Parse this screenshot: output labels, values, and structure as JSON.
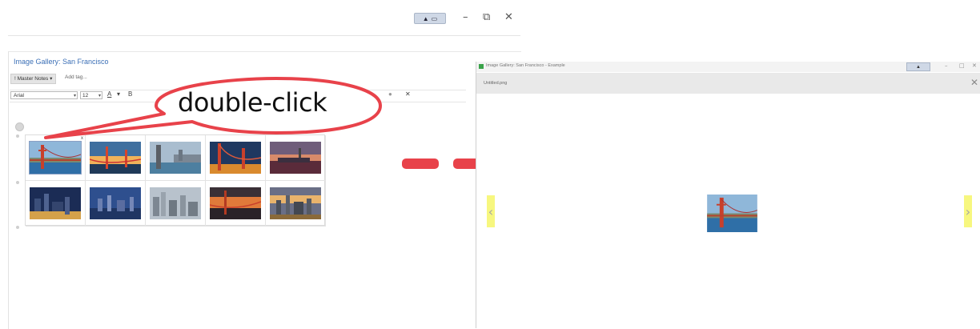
{
  "window": {
    "minimize_glyph": "–",
    "restore_glyph": "⧉",
    "close_glyph": "✕",
    "toggle_glyph": "▲",
    "toggle_sub": "▭"
  },
  "page": {
    "title": "Image Gallery: San Francisco",
    "tag_label": "! Master Notes ▾",
    "add_tag": "Add tag..."
  },
  "format_bar": {
    "font": "Arial",
    "size": "12",
    "icons": [
      "A",
      "▾",
      "B",
      "●",
      "✕"
    ]
  },
  "callout": {
    "text": "double-click"
  },
  "gallery": {
    "rows": 2,
    "columns": 5,
    "thumbnails": [
      "golden-gate-thumbnail",
      "golden-gate-sunset-thumbnail",
      "bay-bridge-thumbnail",
      "golden-gate-night-thumbnail",
      "skyline-dusk-thumbnail",
      "city-night-thumbnail",
      "skyline-blue-hour-thumbnail",
      "downtown-aerial-thumbnail",
      "bridge-fog-sunset-thumbnail",
      "skyline-sunset-thumbnail"
    ],
    "close_glyph": "x"
  },
  "viewer": {
    "title": "Image Gallery: San Francisco - Example",
    "file_name": "Untitled.png",
    "close_glyph": "✕",
    "prev_glyph": "‹",
    "next_glyph": "›",
    "min_glyph": "–",
    "max_glyph": "□",
    "win_close_glyph": "✕"
  },
  "colors": {
    "link_blue": "#3b6fb6",
    "callout_red": "#e8424a",
    "arrow_red": "#e8424a",
    "nav_highlight": "#f7f77f"
  }
}
